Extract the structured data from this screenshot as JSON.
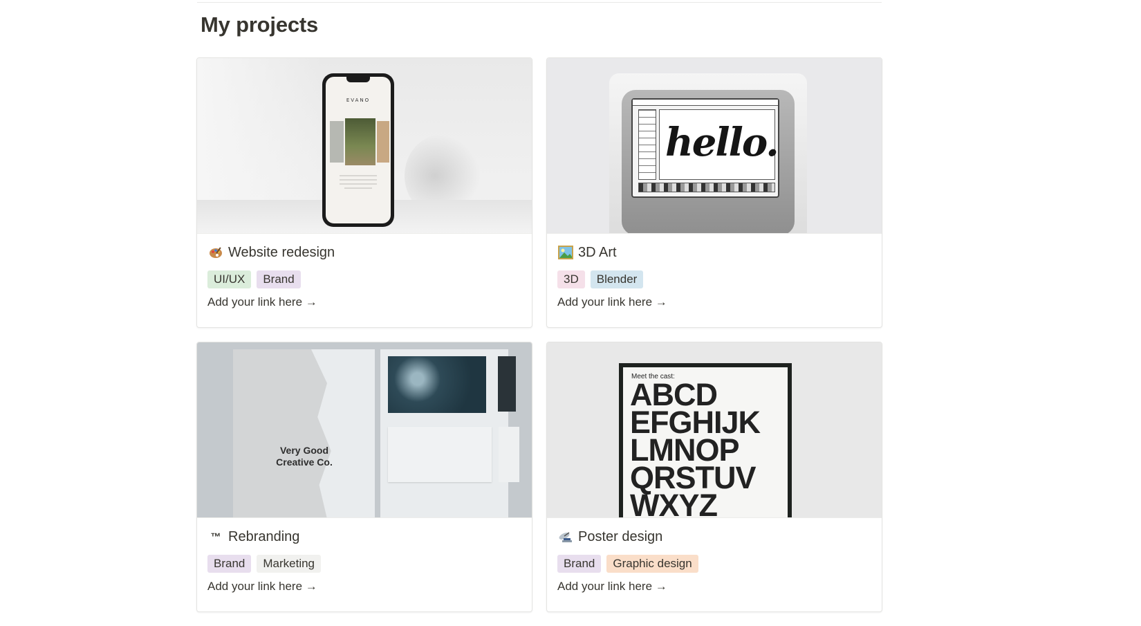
{
  "page": {
    "title": "My projects"
  },
  "projects": [
    {
      "icon": "palette-icon",
      "name": "Website redesign",
      "tags": [
        {
          "label": "UI/UX",
          "color": "#dbeddb"
        },
        {
          "label": "Brand",
          "color": "#e8deee"
        }
      ],
      "link": "Add your link here →",
      "cover": {
        "brand_text": "EVANO"
      }
    },
    {
      "icon": "framed-picture-icon",
      "name": "3D Art",
      "tags": [
        {
          "label": "3D",
          "color": "#f5e0e9"
        },
        {
          "label": "Blender",
          "color": "#d3e5ef"
        }
      ],
      "link": "Add your link here →",
      "cover": {
        "screen_text": "hello."
      }
    },
    {
      "icon": "trademark-icon",
      "icon_text": "™",
      "name": "Rebranding",
      "tags": [
        {
          "label": "Brand",
          "color": "#e8deee"
        },
        {
          "label": "Marketing",
          "color": "#f1f1ef"
        }
      ],
      "link": "Add your link here →",
      "cover": {
        "card_text": "Very Good Creative Co."
      }
    },
    {
      "icon": "satellite-dish-icon",
      "name": "Poster design",
      "tags": [
        {
          "label": "Brand",
          "color": "#e8deee"
        },
        {
          "label": "Graphic design",
          "color": "#fadec9"
        }
      ],
      "link": "Add your link here →",
      "cover": {
        "caption": "Meet the cast:",
        "letters": "ABCD EFGHIJK LMNOP QRSTUV WXYZ"
      }
    }
  ]
}
